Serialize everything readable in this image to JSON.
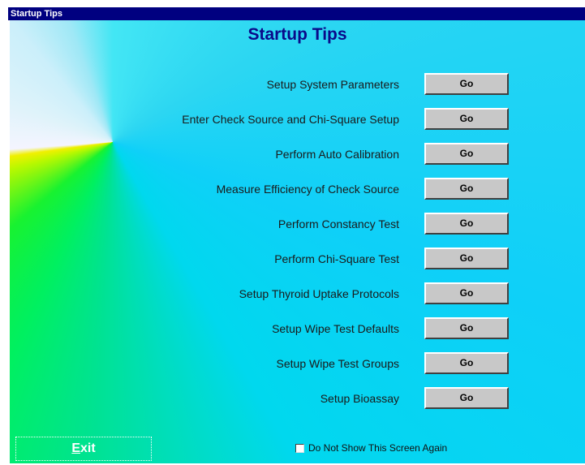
{
  "window": {
    "title": "Startup Tips"
  },
  "heading": "Startup Tips",
  "rows": [
    {
      "label": "Setup System Parameters",
      "button": "Go"
    },
    {
      "label": "Enter Check Source and Chi-Square Setup",
      "button": "Go"
    },
    {
      "label": "Perform Auto Calibration",
      "button": "Go"
    },
    {
      "label": "Measure Efficiency of Check Source",
      "button": "Go"
    },
    {
      "label": "Perform Constancy Test",
      "button": "Go"
    },
    {
      "label": "Perform Chi-Square Test",
      "button": "Go"
    },
    {
      "label": "Setup Thyroid Uptake Protocols",
      "button": "Go"
    },
    {
      "label": "Setup Wipe Test Defaults",
      "button": "Go"
    },
    {
      "label": "Setup Wipe Test Groups",
      "button": "Go"
    },
    {
      "label": "Setup Bioassay",
      "button": "Go"
    }
  ],
  "exit": {
    "hotkey": "E",
    "rest": "xit"
  },
  "checkbox": {
    "label": "Do Not Show This Screen Again",
    "checked": false
  },
  "colors": {
    "titlebar": "#000080",
    "heading": "#0a0a8a",
    "button_face": "#c8c8c8"
  }
}
